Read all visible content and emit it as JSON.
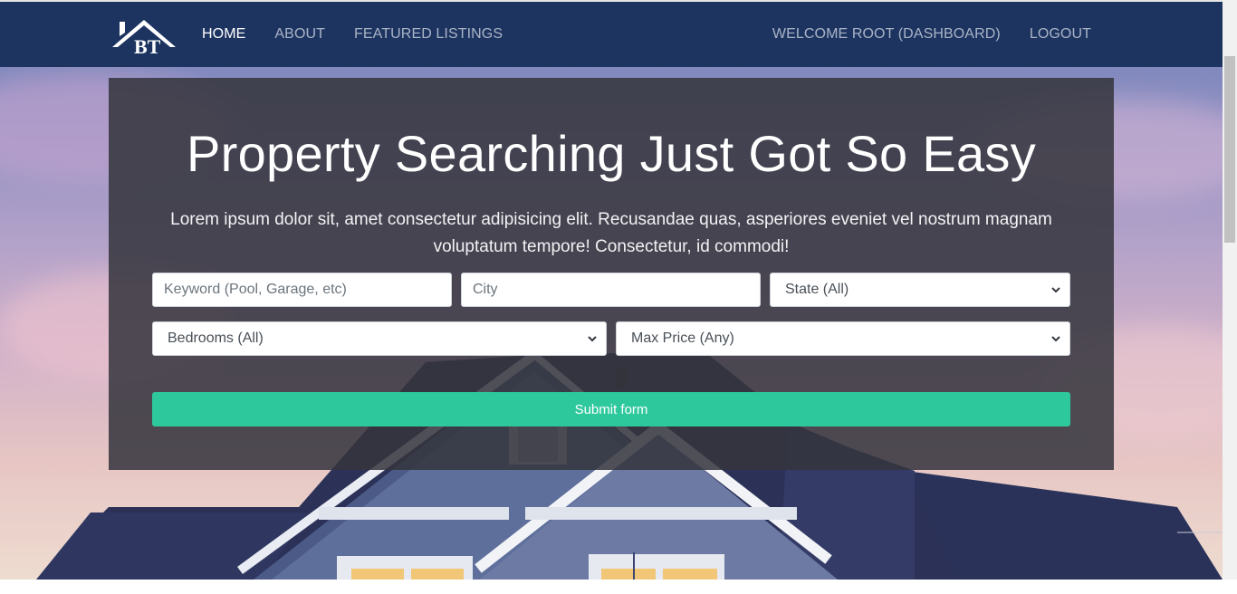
{
  "navbar": {
    "logo_text": "BT",
    "left_links": [
      "HOME",
      "ABOUT",
      "FEATURED LISTINGS"
    ],
    "right_links": [
      "WELCOME ROOT (DASHBOARD)",
      "LOGOUT"
    ],
    "active": "HOME",
    "bg_color": "#1d3461"
  },
  "hero": {
    "title": "Property Searching Just Got So Easy",
    "lead": "Lorem ipsum dolor sit, amet consectetur adipisicing elit. Recusandae quas, asperiores eveniet vel nostrum magnam voluptatum tempore! Consectetur, id commodi!"
  },
  "search": {
    "keyword_placeholder": "Keyword (Pool, Garage, etc)",
    "city_placeholder": "City",
    "state_selected": "State (All)",
    "bedrooms_selected": "Bedrooms (All)",
    "price_selected": "Max Price (Any)",
    "submit_label": "Submit form",
    "submit_color": "#2ec89d"
  },
  "icons": {
    "logo": "house-roof-logo-icon",
    "select_arrow": "chevron-down-icon"
  }
}
